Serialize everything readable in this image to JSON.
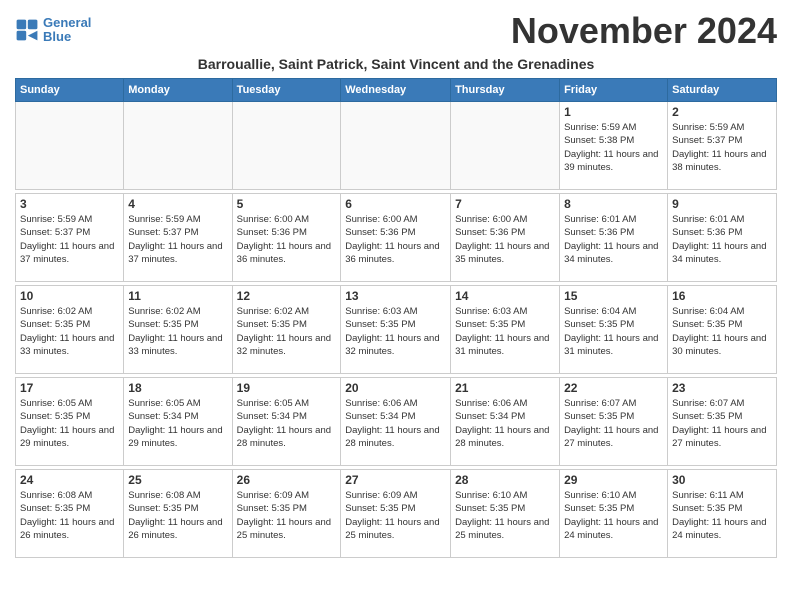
{
  "logo": {
    "line1": "General",
    "line2": "Blue"
  },
  "title": "November 2024",
  "subtitle": "Barrouallie, Saint Patrick, Saint Vincent and the Grenadines",
  "days_of_week": [
    "Sunday",
    "Monday",
    "Tuesday",
    "Wednesday",
    "Thursday",
    "Friday",
    "Saturday"
  ],
  "weeks": [
    [
      {
        "day": "",
        "info": ""
      },
      {
        "day": "",
        "info": ""
      },
      {
        "day": "",
        "info": ""
      },
      {
        "day": "",
        "info": ""
      },
      {
        "day": "",
        "info": ""
      },
      {
        "day": "1",
        "info": "Sunrise: 5:59 AM\nSunset: 5:38 PM\nDaylight: 11 hours and 39 minutes."
      },
      {
        "day": "2",
        "info": "Sunrise: 5:59 AM\nSunset: 5:37 PM\nDaylight: 11 hours and 38 minutes."
      }
    ],
    [
      {
        "day": "3",
        "info": "Sunrise: 5:59 AM\nSunset: 5:37 PM\nDaylight: 11 hours and 37 minutes."
      },
      {
        "day": "4",
        "info": "Sunrise: 5:59 AM\nSunset: 5:37 PM\nDaylight: 11 hours and 37 minutes."
      },
      {
        "day": "5",
        "info": "Sunrise: 6:00 AM\nSunset: 5:36 PM\nDaylight: 11 hours and 36 minutes."
      },
      {
        "day": "6",
        "info": "Sunrise: 6:00 AM\nSunset: 5:36 PM\nDaylight: 11 hours and 36 minutes."
      },
      {
        "day": "7",
        "info": "Sunrise: 6:00 AM\nSunset: 5:36 PM\nDaylight: 11 hours and 35 minutes."
      },
      {
        "day": "8",
        "info": "Sunrise: 6:01 AM\nSunset: 5:36 PM\nDaylight: 11 hours and 34 minutes."
      },
      {
        "day": "9",
        "info": "Sunrise: 6:01 AM\nSunset: 5:36 PM\nDaylight: 11 hours and 34 minutes."
      }
    ],
    [
      {
        "day": "10",
        "info": "Sunrise: 6:02 AM\nSunset: 5:35 PM\nDaylight: 11 hours and 33 minutes."
      },
      {
        "day": "11",
        "info": "Sunrise: 6:02 AM\nSunset: 5:35 PM\nDaylight: 11 hours and 33 minutes."
      },
      {
        "day": "12",
        "info": "Sunrise: 6:02 AM\nSunset: 5:35 PM\nDaylight: 11 hours and 32 minutes."
      },
      {
        "day": "13",
        "info": "Sunrise: 6:03 AM\nSunset: 5:35 PM\nDaylight: 11 hours and 32 minutes."
      },
      {
        "day": "14",
        "info": "Sunrise: 6:03 AM\nSunset: 5:35 PM\nDaylight: 11 hours and 31 minutes."
      },
      {
        "day": "15",
        "info": "Sunrise: 6:04 AM\nSunset: 5:35 PM\nDaylight: 11 hours and 31 minutes."
      },
      {
        "day": "16",
        "info": "Sunrise: 6:04 AM\nSunset: 5:35 PM\nDaylight: 11 hours and 30 minutes."
      }
    ],
    [
      {
        "day": "17",
        "info": "Sunrise: 6:05 AM\nSunset: 5:35 PM\nDaylight: 11 hours and 29 minutes."
      },
      {
        "day": "18",
        "info": "Sunrise: 6:05 AM\nSunset: 5:34 PM\nDaylight: 11 hours and 29 minutes."
      },
      {
        "day": "19",
        "info": "Sunrise: 6:05 AM\nSunset: 5:34 PM\nDaylight: 11 hours and 28 minutes."
      },
      {
        "day": "20",
        "info": "Sunrise: 6:06 AM\nSunset: 5:34 PM\nDaylight: 11 hours and 28 minutes."
      },
      {
        "day": "21",
        "info": "Sunrise: 6:06 AM\nSunset: 5:34 PM\nDaylight: 11 hours and 28 minutes."
      },
      {
        "day": "22",
        "info": "Sunrise: 6:07 AM\nSunset: 5:35 PM\nDaylight: 11 hours and 27 minutes."
      },
      {
        "day": "23",
        "info": "Sunrise: 6:07 AM\nSunset: 5:35 PM\nDaylight: 11 hours and 27 minutes."
      }
    ],
    [
      {
        "day": "24",
        "info": "Sunrise: 6:08 AM\nSunset: 5:35 PM\nDaylight: 11 hours and 26 minutes."
      },
      {
        "day": "25",
        "info": "Sunrise: 6:08 AM\nSunset: 5:35 PM\nDaylight: 11 hours and 26 minutes."
      },
      {
        "day": "26",
        "info": "Sunrise: 6:09 AM\nSunset: 5:35 PM\nDaylight: 11 hours and 25 minutes."
      },
      {
        "day": "27",
        "info": "Sunrise: 6:09 AM\nSunset: 5:35 PM\nDaylight: 11 hours and 25 minutes."
      },
      {
        "day": "28",
        "info": "Sunrise: 6:10 AM\nSunset: 5:35 PM\nDaylight: 11 hours and 25 minutes."
      },
      {
        "day": "29",
        "info": "Sunrise: 6:10 AM\nSunset: 5:35 PM\nDaylight: 11 hours and 24 minutes."
      },
      {
        "day": "30",
        "info": "Sunrise: 6:11 AM\nSunset: 5:35 PM\nDaylight: 11 hours and 24 minutes."
      }
    ]
  ]
}
